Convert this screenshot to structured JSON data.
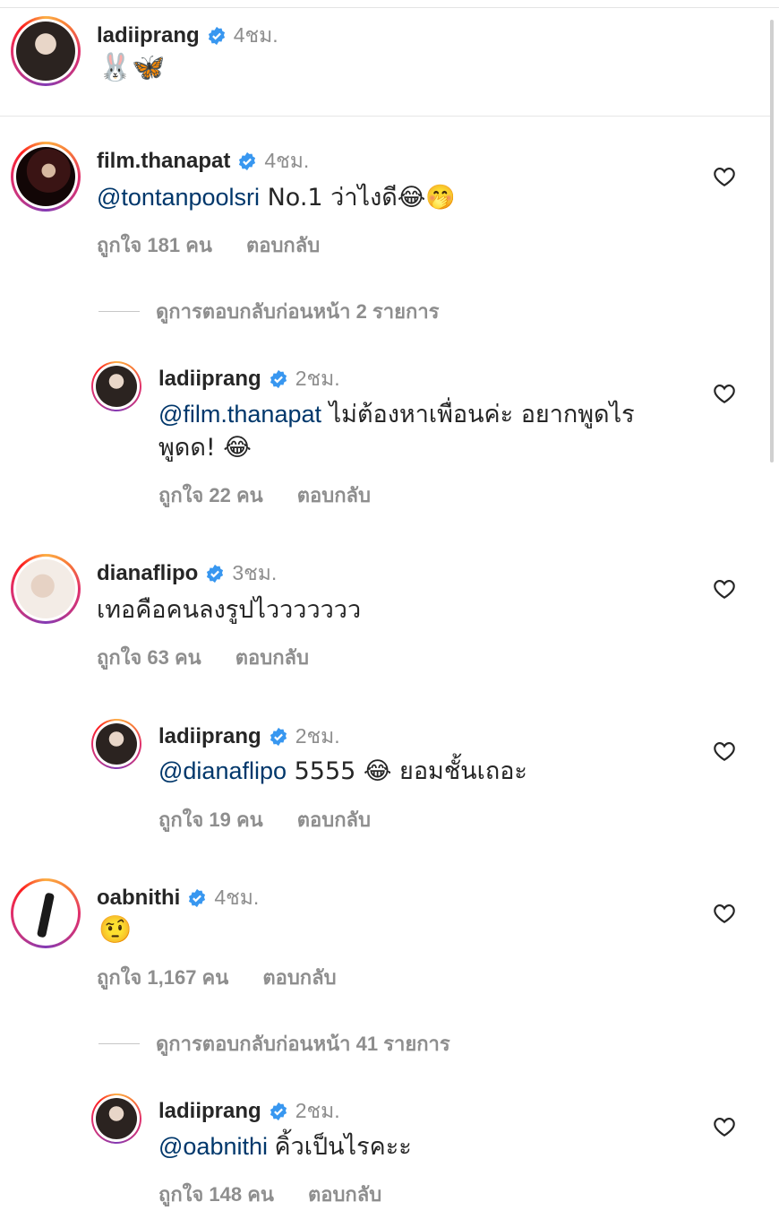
{
  "caption": {
    "username": "ladiiprang",
    "time": "4ชม.",
    "text": "🐰🦋"
  },
  "labels": {
    "likes_prefix": "ถูกใจ",
    "reply": "ตอบกลับ"
  },
  "comments": [
    {
      "username": "film.thanapat",
      "time": "4ชม.",
      "mention": "@tontanpoolsri",
      "text": " No.1 ว่าไงดี😂🤭",
      "likes": "ถูกใจ 181 คน",
      "reply": "ตอบกลับ",
      "view_more": "ดูการตอบกลับก่อนหน้า 2 รายการ",
      "replies": [
        {
          "username": "ladiiprang",
          "time": "2ชม.",
          "mention": "@film.thanapat",
          "text": " ไม่ต้องหาเพื่อนค่ะ อยากพูดไร พูดด! 😂",
          "likes": "ถูกใจ 22 คน",
          "reply": "ตอบกลับ"
        }
      ]
    },
    {
      "username": "dianaflipo",
      "time": "3ชม.",
      "mention": "",
      "text": "เทอคือคนลงรูปไววววววว",
      "likes": "ถูกใจ 63 คน",
      "reply": "ตอบกลับ",
      "replies": [
        {
          "username": "ladiiprang",
          "time": "2ชม.",
          "mention": "@dianaflipo",
          "text": " 5555 😂 ยอมชั้นเถอะ",
          "likes": "ถูกใจ 19 คน",
          "reply": "ตอบกลับ"
        }
      ]
    },
    {
      "username": "oabnithi",
      "time": "4ชม.",
      "mention": "",
      "text": "🤨",
      "likes": "ถูกใจ 1,167 คน",
      "reply": "ตอบกลับ",
      "view_more": "ดูการตอบกลับก่อนหน้า 41 รายการ",
      "replies": [
        {
          "username": "ladiiprang",
          "time": "2ชม.",
          "mention": "@oabnithi",
          "text": " คิ้วเป็นไรคะะ",
          "likes": "ถูกใจ 148 คน",
          "reply": "ตอบกลับ"
        }
      ]
    }
  ],
  "colors": {
    "verified": "#3897f0",
    "mention": "#00376b",
    "muted": "#8e8e8e"
  },
  "icons": {
    "verified": "verified-badge-icon",
    "like": "heart-outline-icon"
  }
}
